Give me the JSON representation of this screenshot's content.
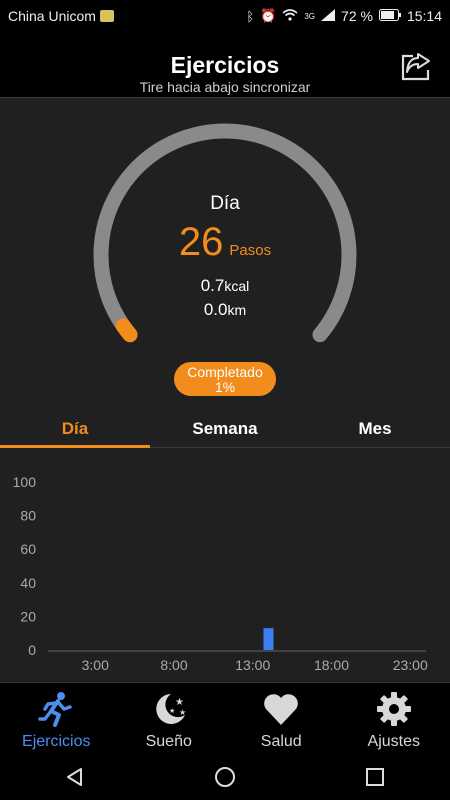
{
  "status": {
    "carrier": "China Unicom",
    "battery": "72 %",
    "time": "15:14",
    "network": "3G"
  },
  "header": {
    "title": "Ejercicios",
    "subtitle": "Tire hacia abajo sincronizar"
  },
  "summary": {
    "period": "Día",
    "steps_value": "26",
    "steps_unit": "Pasos",
    "kcal_value": "0.7",
    "kcal_unit": "kcal",
    "km_value": "0.0",
    "km_unit": "km",
    "completed_label": "Completado",
    "completed_percent": "1%",
    "progress": 0.01
  },
  "tabs": [
    {
      "label": "Día"
    },
    {
      "label": "Semana"
    },
    {
      "label": "Mes"
    }
  ],
  "chart_data": {
    "type": "bar",
    "x_ticks": [
      "3:00",
      "8:00",
      "13:00",
      "18:00",
      "23:00"
    ],
    "y_ticks": [
      "100",
      "80",
      "60",
      "40",
      "20",
      "0"
    ],
    "ylim": [
      0,
      100
    ],
    "xlim": [
      0,
      24
    ],
    "bars": [
      {
        "hour": 14,
        "value": 13
      }
    ],
    "bar_color": "#3b7ff0"
  },
  "nav": [
    {
      "label": "Ejercicios",
      "icon": "running-icon"
    },
    {
      "label": "Sueño",
      "icon": "moon-icon"
    },
    {
      "label": "Salud",
      "icon": "heart-icon"
    },
    {
      "label": "Ajustes",
      "icon": "gear-icon"
    }
  ],
  "colors": {
    "accent": "#f28c1c",
    "active_nav": "#4d8ef0",
    "ring_gray": "#8a8a8a"
  }
}
